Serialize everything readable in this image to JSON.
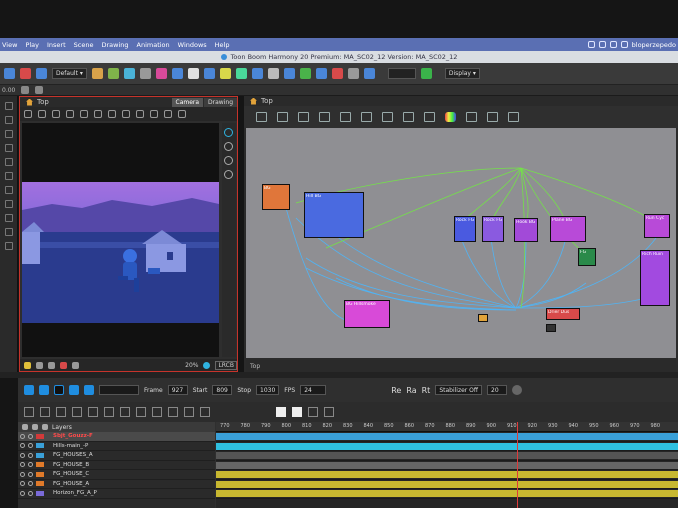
{
  "menu": [
    "View",
    "Play",
    "Insert",
    "Scene",
    "Drawing",
    "Animation",
    "Windows",
    "Help"
  ],
  "menu_right": {
    "user": "bloperzepedo"
  },
  "window_title": "Toon Boom Harmony 20 Premium: MA_SC02_12 Version: MA_SC02_12",
  "toolbar": {
    "preset": "Default",
    "display": "Display"
  },
  "toolbar2": {
    "value": "0.00"
  },
  "camera_view": {
    "breadcrumb": "Top",
    "tabs": [
      "Camera",
      "Drawing"
    ],
    "zoom": "20%",
    "colorspace": "LRCB"
  },
  "node_view": {
    "breadcrumb": "Top",
    "footer": "Top",
    "nodes": [
      {
        "label": "BG"
      },
      {
        "label": "Hill BG"
      },
      {
        "label": "Rock FG"
      },
      {
        "label": "Rock FG"
      },
      {
        "label": "Hook BG"
      },
      {
        "label": "Plane BG"
      },
      {
        "label": "Run Cyc"
      },
      {
        "label": "Rich Ruin"
      },
      {
        "label": "BG Hillsmoke"
      },
      {
        "label": "FG"
      },
      {
        "label": "Drier Dus"
      }
    ]
  },
  "timeline": {
    "frame_label": "Frame",
    "frame": "927",
    "start_label": "Start",
    "start": "809",
    "stop_label": "Stop",
    "stop": "1030",
    "fps_label": "FPS",
    "fps": "24",
    "stabilizer": "Stabilizer Off",
    "stabilizer_value": "20",
    "glyphs": [
      "Re",
      "Ra",
      "Rt"
    ],
    "layers_title": "Layers",
    "ruler": [
      "770",
      "780",
      "790",
      "800",
      "810",
      "820",
      "830",
      "840",
      "850",
      "860",
      "870",
      "880",
      "890",
      "900",
      "910",
      "920",
      "930",
      "940",
      "950",
      "960",
      "970",
      "980"
    ],
    "playhead_label": "930",
    "layers": [
      {
        "name": "Sbjt_Gouzz-F",
        "color": "#d23a3a",
        "selected": true
      },
      {
        "name": "Hills-main_-P",
        "color": "#3aa0d8",
        "selected": false
      },
      {
        "name": "FG_HOUSES_A",
        "color": "#3aa0d8",
        "selected": false
      },
      {
        "name": "FG_HOUSE_B",
        "color": "#e07a2a",
        "selected": false
      },
      {
        "name": "FG_HOUSE_C",
        "color": "#e07a2a",
        "selected": false
      },
      {
        "name": "FG_HOUSE_A",
        "color": "#e07a2a",
        "selected": false
      },
      {
        "name": "Horizon_FG_A_P",
        "color": "#7a6ad8",
        "selected": false
      }
    ]
  }
}
